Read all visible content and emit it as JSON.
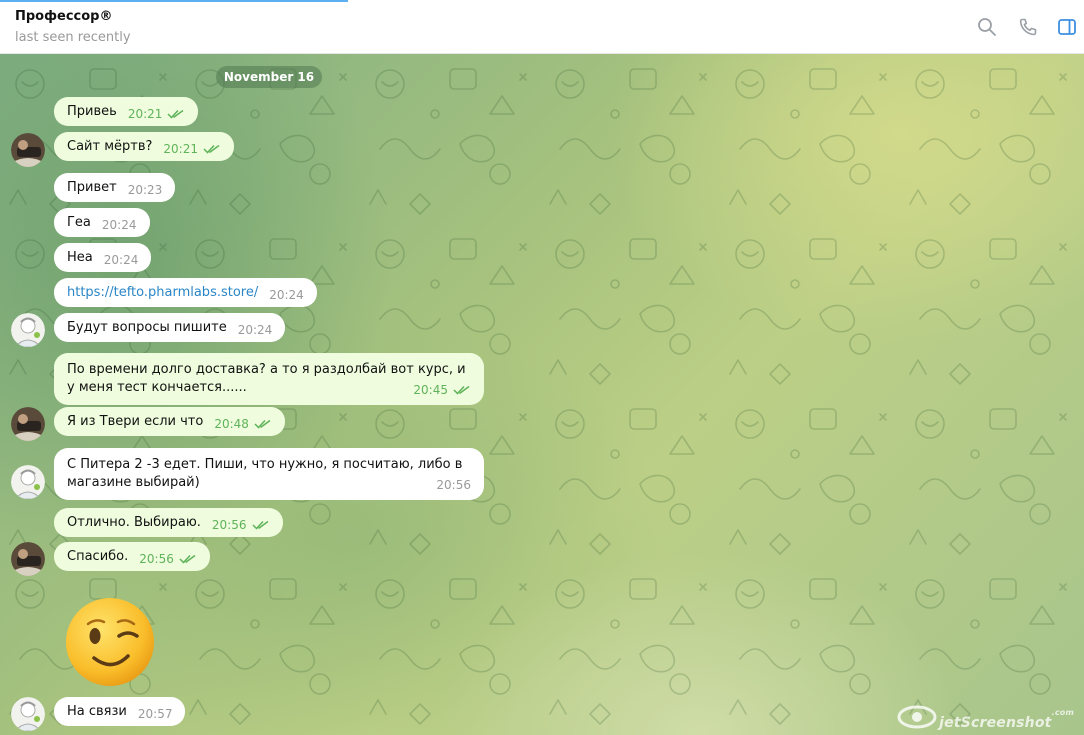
{
  "header": {
    "title": "Профессор®",
    "status": "last seen recently",
    "icons": [
      "search-icon",
      "phone-icon",
      "sidebar-toggle-icon"
    ]
  },
  "chat": {
    "date": "November 16",
    "messages": [
      {
        "text": "Привеь",
        "time": "20:21",
        "direction": "out",
        "read": true
      },
      {
        "text": "Сайт мёртв?",
        "time": "20:21",
        "direction": "out",
        "read": true
      },
      {
        "text": "Привет",
        "time": "20:23",
        "direction": "in"
      },
      {
        "text": "Геа",
        "time": "20:24",
        "direction": "in"
      },
      {
        "text": "Неа",
        "time": "20:24",
        "direction": "in"
      },
      {
        "text": "https://tefto.pharmlabs.store/",
        "time": "20:24",
        "direction": "in",
        "link": true
      },
      {
        "text": "Будут вопросы пишите",
        "time": "20:24",
        "direction": "in"
      },
      {
        "text": "По времени долго доставка? а то я раздолбай вот курс, и у меня тест кончается......",
        "time": "20:45",
        "direction": "out",
        "read": true
      },
      {
        "text": "Я из Твери если что",
        "time": "20:48",
        "direction": "out",
        "read": true
      },
      {
        "text": "С Питера 2 -3 едет. Пиши, что нужно, я посчитаю, либо в магазине выбирай)",
        "time": "20:56",
        "direction": "in"
      },
      {
        "text": "Отлично. Выбираю.",
        "time": "20:56",
        "direction": "out",
        "read": true
      },
      {
        "text": "Спасибо.",
        "time": "20:56",
        "direction": "out",
        "read": true
      },
      {
        "text": "На связи",
        "time": "20:57",
        "direction": "in"
      }
    ],
    "sticker": "winking-face-emoji"
  },
  "watermark": {
    "text": "jetScreenshot",
    "small": ".com"
  },
  "colors": {
    "accent": "#5caff0",
    "outgoing_bubble": "#effdde",
    "incoming_bubble": "#ffffff",
    "read_check": "#5fb35a",
    "link": "#2a86c8"
  }
}
